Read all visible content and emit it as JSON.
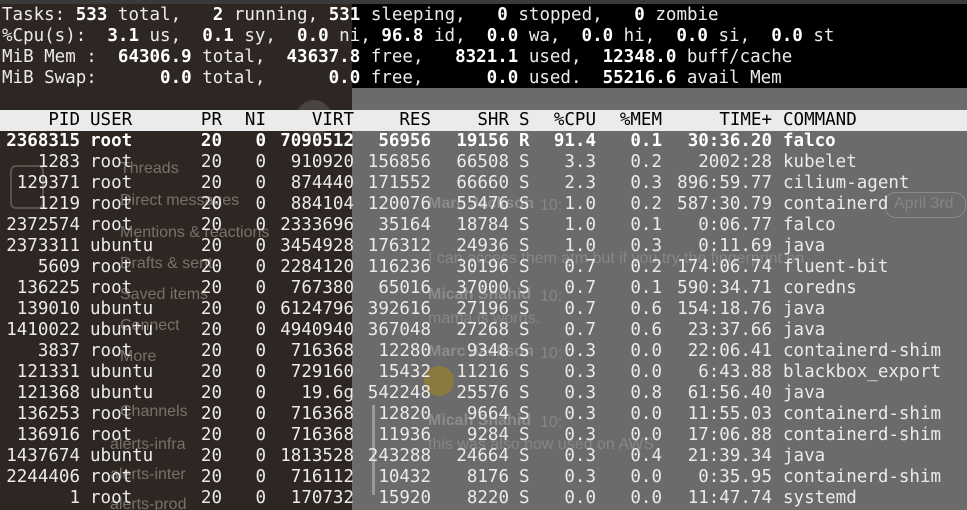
{
  "background_app": {
    "channels_header": "Channels",
    "sidebar_items": [
      "Threads",
      "Direct messages",
      "Mentions & reactions",
      "Drafts & sent",
      "Saved items",
      "Connect",
      "More"
    ],
    "channels": [
      "alerts-infra",
      "alerts-inter",
      "alerts-prod"
    ],
    "main": {
      "date_pill": "April 3rd",
      "messages": [
        {
          "author": "Marc Jackson",
          "time": "10:",
          "text": "I can access them atm but if you try the fingerprint on"
        },
        {
          "author": "Micah Shahid",
          "time": "10:",
          "text": "mama is words."
        },
        {
          "author": "Marc Jackson",
          "time": "10:",
          "text": ""
        },
        {
          "author": "Micah Shahid",
          "time": "10:",
          "text": "this was also now used on AWS"
        }
      ]
    }
  },
  "summary": {
    "tasks": {
      "label": "Tasks:",
      "total": "533",
      "total_label": "total,",
      "running": "2",
      "running_label": "running,",
      "sleeping": "531",
      "sleeping_label": "sleeping,",
      "stopped": "0",
      "stopped_label": "stopped,",
      "zombie": "0",
      "zombie_label": "zombie"
    },
    "cpu": {
      "label": "%Cpu(s):",
      "us": "3.1",
      "sy": "0.1",
      "ni": "0.0",
      "id": "96.8",
      "wa": "0.0",
      "hi": "0.0",
      "si": "0.0",
      "st": "0.0"
    },
    "mem": {
      "label": "MiB Mem :",
      "total": "64306.9",
      "free": "43637.8",
      "used": "8321.1",
      "buff_cache": "12348.0"
    },
    "swap": {
      "label": "MiB Swap:",
      "total": "0.0",
      "free": "0.0",
      "used": "0.0",
      "avail": "55216.6"
    }
  },
  "columns": [
    "PID",
    "USER",
    "PR",
    "NI",
    "VIRT",
    "RES",
    "SHR",
    "S",
    "%CPU",
    "%MEM",
    "TIME+",
    "COMMAND"
  ],
  "processes": [
    {
      "pid": "2368315",
      "user": "root",
      "pr": "20",
      "ni": "0",
      "virt": "7090512",
      "res": "56956",
      "shr": "19156",
      "s": "R",
      "cpu": "91.4",
      "mem": "0.1",
      "time": "30:36.20",
      "command": "falco"
    },
    {
      "pid": "1283",
      "user": "root",
      "pr": "20",
      "ni": "0",
      "virt": "910920",
      "res": "156856",
      "shr": "66508",
      "s": "S",
      "cpu": "3.3",
      "mem": "0.2",
      "time": "2002:28",
      "command": "kubelet"
    },
    {
      "pid": "129371",
      "user": "root",
      "pr": "20",
      "ni": "0",
      "virt": "874440",
      "res": "171552",
      "shr": "66660",
      "s": "S",
      "cpu": "2.3",
      "mem": "0.3",
      "time": "896:59.77",
      "command": "cilium-agent"
    },
    {
      "pid": "1219",
      "user": "root",
      "pr": "20",
      "ni": "0",
      "virt": "884104",
      "res": "120076",
      "shr": "55476",
      "s": "S",
      "cpu": "1.0",
      "mem": "0.2",
      "time": "587:30.79",
      "command": "containerd"
    },
    {
      "pid": "2372574",
      "user": "root",
      "pr": "20",
      "ni": "0",
      "virt": "2333696",
      "res": "35164",
      "shr": "18784",
      "s": "S",
      "cpu": "1.0",
      "mem": "0.1",
      "time": "0:06.77",
      "command": "falco"
    },
    {
      "pid": "2373311",
      "user": "ubuntu",
      "pr": "20",
      "ni": "0",
      "virt": "3454928",
      "res": "176312",
      "shr": "24936",
      "s": "S",
      "cpu": "1.0",
      "mem": "0.3",
      "time": "0:11.69",
      "command": "java"
    },
    {
      "pid": "5609",
      "user": "root",
      "pr": "20",
      "ni": "0",
      "virt": "2284120",
      "res": "116236",
      "shr": "30196",
      "s": "S",
      "cpu": "0.7",
      "mem": "0.2",
      "time": "174:06.74",
      "command": "fluent-bit"
    },
    {
      "pid": "136225",
      "user": "root",
      "pr": "20",
      "ni": "0",
      "virt": "767380",
      "res": "65016",
      "shr": "37000",
      "s": "S",
      "cpu": "0.7",
      "mem": "0.1",
      "time": "590:34.71",
      "command": "coredns"
    },
    {
      "pid": "139010",
      "user": "ubuntu",
      "pr": "20",
      "ni": "0",
      "virt": "6124796",
      "res": "392616",
      "shr": "27196",
      "s": "S",
      "cpu": "0.7",
      "mem": "0.6",
      "time": "154:18.76",
      "command": "java"
    },
    {
      "pid": "1410022",
      "user": "ubuntu",
      "pr": "20",
      "ni": "0",
      "virt": "4940940",
      "res": "367048",
      "shr": "27268",
      "s": "S",
      "cpu": "0.7",
      "mem": "0.6",
      "time": "23:37.66",
      "command": "java"
    },
    {
      "pid": "3837",
      "user": "root",
      "pr": "20",
      "ni": "0",
      "virt": "716368",
      "res": "12280",
      "shr": "9348",
      "s": "S",
      "cpu": "0.3",
      "mem": "0.0",
      "time": "22:06.41",
      "command": "containerd-shim"
    },
    {
      "pid": "121331",
      "user": "ubuntu",
      "pr": "20",
      "ni": "0",
      "virt": "729160",
      "res": "15432",
      "shr": "11216",
      "s": "S",
      "cpu": "0.3",
      "mem": "0.0",
      "time": "6:43.88",
      "command": "blackbox_export"
    },
    {
      "pid": "121368",
      "user": "ubuntu",
      "pr": "20",
      "ni": "0",
      "virt": "19.6g",
      "res": "542248",
      "shr": "25576",
      "s": "S",
      "cpu": "0.3",
      "mem": "0.8",
      "time": "61:56.40",
      "command": "java"
    },
    {
      "pid": "136253",
      "user": "root",
      "pr": "20",
      "ni": "0",
      "virt": "716368",
      "res": "12820",
      "shr": "9664",
      "s": "S",
      "cpu": "0.3",
      "mem": "0.0",
      "time": "11:55.03",
      "command": "containerd-shim"
    },
    {
      "pid": "136916",
      "user": "root",
      "pr": "20",
      "ni": "0",
      "virt": "716368",
      "res": "11936",
      "shr": "9284",
      "s": "S",
      "cpu": "0.3",
      "mem": "0.0",
      "time": "17:06.88",
      "command": "containerd-shim"
    },
    {
      "pid": "1437674",
      "user": "ubuntu",
      "pr": "20",
      "ni": "0",
      "virt": "1813528",
      "res": "243288",
      "shr": "24664",
      "s": "S",
      "cpu": "0.3",
      "mem": "0.4",
      "time": "21:39.34",
      "command": "java"
    },
    {
      "pid": "2244406",
      "user": "root",
      "pr": "20",
      "ni": "0",
      "virt": "716112",
      "res": "10432",
      "shr": "8176",
      "s": "S",
      "cpu": "0.3",
      "mem": "0.0",
      "time": "0:35.95",
      "command": "containerd-shim"
    },
    {
      "pid": "1",
      "user": "root",
      "pr": "20",
      "ni": "0",
      "virt": "170732",
      "res": "15920",
      "shr": "8220",
      "s": "S",
      "cpu": "0.0",
      "mem": "0.0",
      "time": "11:47.74",
      "command": "systemd"
    }
  ],
  "colors": {
    "terminal_bg": "#000000",
    "text": "#ebebeb",
    "header_bg": "#ebebeb",
    "header_fg": "#000000"
  }
}
